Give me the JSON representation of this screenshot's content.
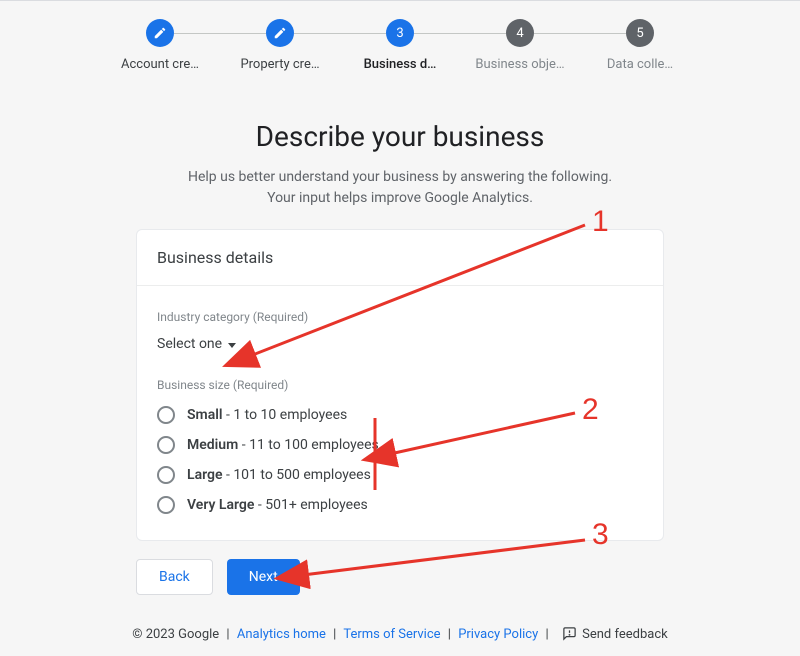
{
  "stepper": {
    "steps": [
      {
        "label": "Account cre…",
        "state": "done"
      },
      {
        "label": "Property cre…",
        "state": "done"
      },
      {
        "label": "Business d…",
        "state": "active",
        "num": "3"
      },
      {
        "label": "Business obje…",
        "state": "inactive",
        "num": "4"
      },
      {
        "label": "Data colle…",
        "state": "inactive",
        "num": "5"
      }
    ]
  },
  "heading": "Describe your business",
  "subheading_line1": "Help us better understand your business by answering the following.",
  "subheading_line2": "Your input helps improve Google Analytics.",
  "card": {
    "title": "Business details",
    "industry_label": "Industry category (Required)",
    "industry_value": "Select one",
    "size_label": "Business size (Required)",
    "size_options": [
      {
        "bold": "Small",
        "rest": " - 1 to 10 employees"
      },
      {
        "bold": "Medium",
        "rest": " - 11 to 100 employees"
      },
      {
        "bold": "Large",
        "rest": " - 101 to 500 employees"
      },
      {
        "bold": "Very Large",
        "rest": " - 501+ employees"
      }
    ]
  },
  "actions": {
    "back": "Back",
    "next": "Next"
  },
  "footer": {
    "copyright": "© 2023 Google",
    "links": [
      "Analytics home",
      "Terms of Service",
      "Privacy Policy"
    ],
    "feedback": "Send feedback"
  },
  "annotations": {
    "n1": "1",
    "n2": "2",
    "n3": "3"
  }
}
